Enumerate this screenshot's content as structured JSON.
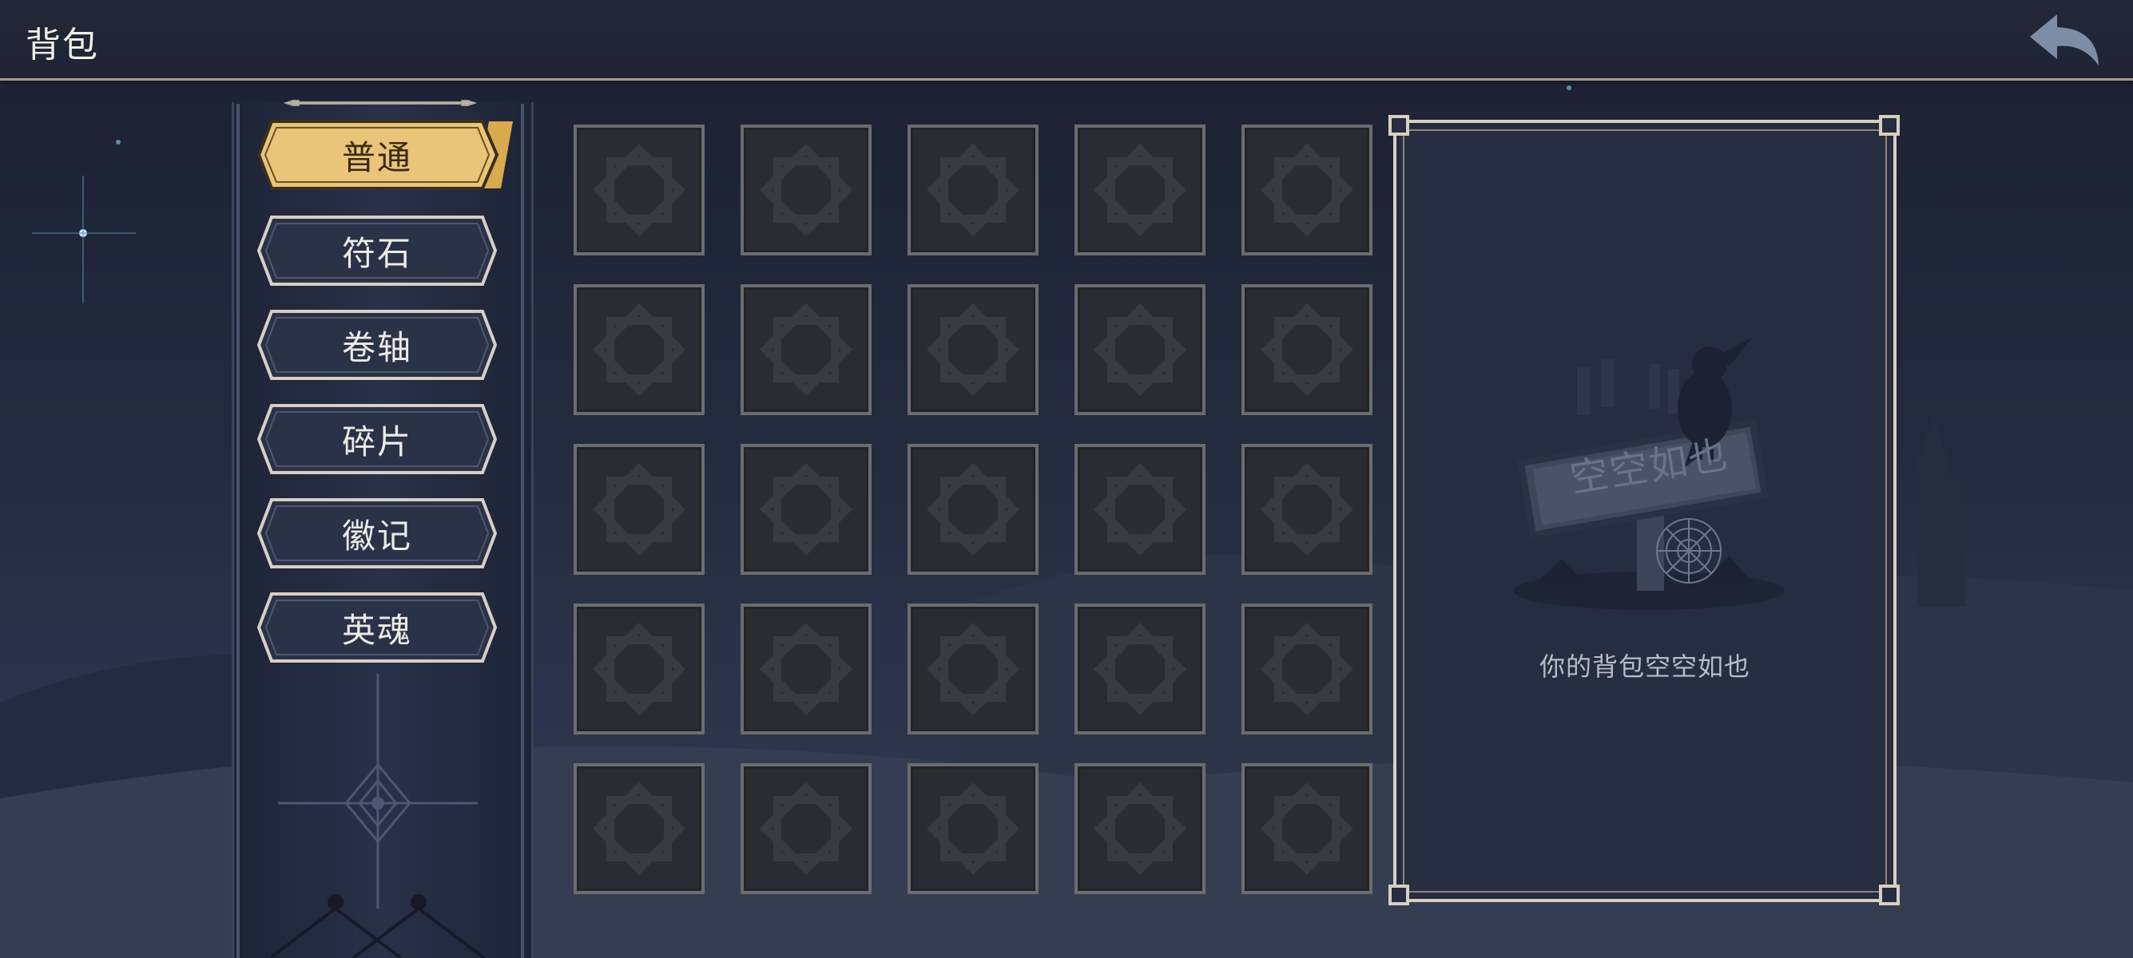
{
  "header": {
    "title": "背包",
    "back_icon": "return-arrow-icon"
  },
  "categories": [
    {
      "label": "普通",
      "active": true
    },
    {
      "label": "符石",
      "active": false
    },
    {
      "label": "卷轴",
      "active": false
    },
    {
      "label": "碎片",
      "active": false
    },
    {
      "label": "徽记",
      "active": false
    },
    {
      "label": "英魂",
      "active": false
    }
  ],
  "grid": {
    "rows": 5,
    "columns": 5,
    "slots_filled": 0,
    "slot_icon": "empty-slot-emblem-icon"
  },
  "detail": {
    "sign_text": "空空如也",
    "empty_message": "你的背包空空如也",
    "art_icon": "crow-on-signpost-icon"
  },
  "colors": {
    "active_tab": "#e9c57a",
    "inactive_tab": "#2a3248",
    "tab_border": "#d6d0c4",
    "panel_border": "#d9cfbf",
    "slot_border": "#6c6c6e"
  }
}
